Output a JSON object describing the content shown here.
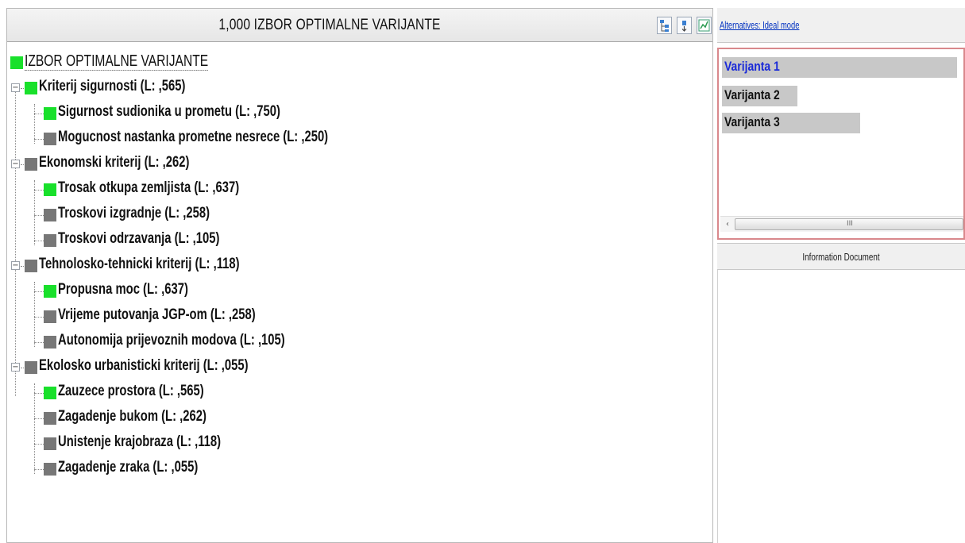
{
  "header": {
    "title": "1,000  IZBOR OPTIMALNE VARIJANTE",
    "toolbar_icons": [
      "tree-view-icon",
      "sort-icon",
      "chart-icon"
    ]
  },
  "tree": {
    "root": "IZBOR OPTIMALNE VARIJANTE",
    "criteria": [
      {
        "label": "Kriterij sigurnosti (L: ,565)",
        "status": "green",
        "children": [
          {
            "label": "Sigurnost sudionika u prometu (L: ,750)",
            "status": "green"
          },
          {
            "label": "Mogucnost nastanka prometne nesrece (L: ,250)",
            "status": "gray"
          }
        ]
      },
      {
        "label": "Ekonomski kriterij (L: ,262)",
        "status": "gray",
        "children": [
          {
            "label": "Trosak otkupa zemljista (L: ,637)",
            "status": "green"
          },
          {
            "label": "Troskovi izgradnje (L: ,258)",
            "status": "gray"
          },
          {
            "label": "Troskovi odrzavanja (L: ,105)",
            "status": "gray"
          }
        ]
      },
      {
        "label": "Tehnolosko-tehnicki kriterij (L: ,118)",
        "status": "gray",
        "children": [
          {
            "label": "Propusna moc (L: ,637)",
            "status": "green"
          },
          {
            "label": "Vrijeme putovanja JGP-om (L: ,258)",
            "status": "gray"
          },
          {
            "label": "Autonomija prijevoznih modova (L: ,105)",
            "status": "gray"
          }
        ]
      },
      {
        "label": "Ekolosko urbanisticki kriterij (L: ,055)",
        "status": "gray",
        "children": [
          {
            "label": "Zauzece prostora (L: ,565)",
            "status": "green"
          },
          {
            "label": "Zagadenje bukom (L: ,262)",
            "status": "gray"
          },
          {
            "label": "Unistenje krajobraza (L: ,118)",
            "status": "gray"
          },
          {
            "label": "Zagadenje zraka (L: ,055)",
            "status": "gray"
          }
        ]
      }
    ]
  },
  "alternatives": {
    "header_link": "Alternatives: Ideal mode",
    "items": [
      {
        "label": "Varijanta 1",
        "value": 1.0,
        "selected": true
      },
      {
        "label": "Varijanta 2",
        "value": 0.32,
        "selected": false
      },
      {
        "label": "Varijanta 3",
        "value": 0.589,
        "selected": false
      }
    ],
    "scroll_grip": "III",
    "scroll_left": "‹"
  },
  "info": {
    "title": "Information Document"
  },
  "colors": {
    "green": "#19e02b",
    "gray": "#777777",
    "selected_text": "#1a2ad8",
    "alt_border": "#d9888c"
  }
}
